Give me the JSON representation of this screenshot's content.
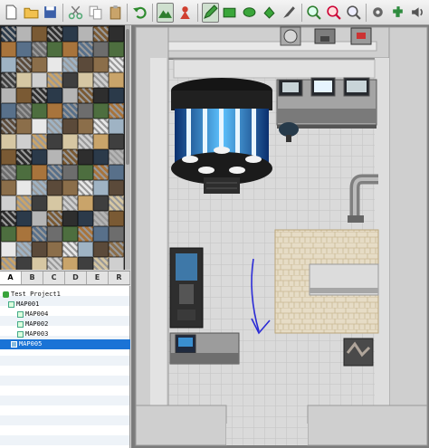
{
  "toolbar": {
    "tools": [
      {
        "name": "new-project-icon"
      },
      {
        "name": "open-project-icon"
      },
      {
        "name": "save-project-icon"
      },
      {
        "name": "cut-icon"
      },
      {
        "name": "copy-icon"
      },
      {
        "name": "paste-icon"
      },
      {
        "name": "undo-icon"
      },
      {
        "name": "map-mode-icon",
        "active": true
      },
      {
        "name": "event-mode-icon"
      },
      {
        "name": "pencil-icon",
        "active": true
      },
      {
        "name": "rectangle-icon"
      },
      {
        "name": "ellipse-icon"
      },
      {
        "name": "fill-icon"
      },
      {
        "name": "shadow-pen-icon"
      },
      {
        "name": "zoom-in-icon"
      },
      {
        "name": "zoom-out-icon"
      },
      {
        "name": "zoom-actual-icon"
      },
      {
        "name": "settings-icon"
      },
      {
        "name": "plugin-icon"
      },
      {
        "name": "sound-icon"
      }
    ]
  },
  "tileset_tabs": [
    "A",
    "B",
    "C",
    "D",
    "E",
    "R"
  ],
  "active_tab": "A",
  "tree": {
    "project": "Test Project1",
    "root_map": "MAP001",
    "children": [
      "MAP004",
      "MAP002",
      "MAP003",
      "MAP005"
    ],
    "selected": "MAP005"
  },
  "colors": {
    "selection": "#1a73d6",
    "floor": "#d9d9d9",
    "wall": "#8d8d8d",
    "hologram": "#3aa3f5",
    "arrow": "#2a2ad6"
  }
}
